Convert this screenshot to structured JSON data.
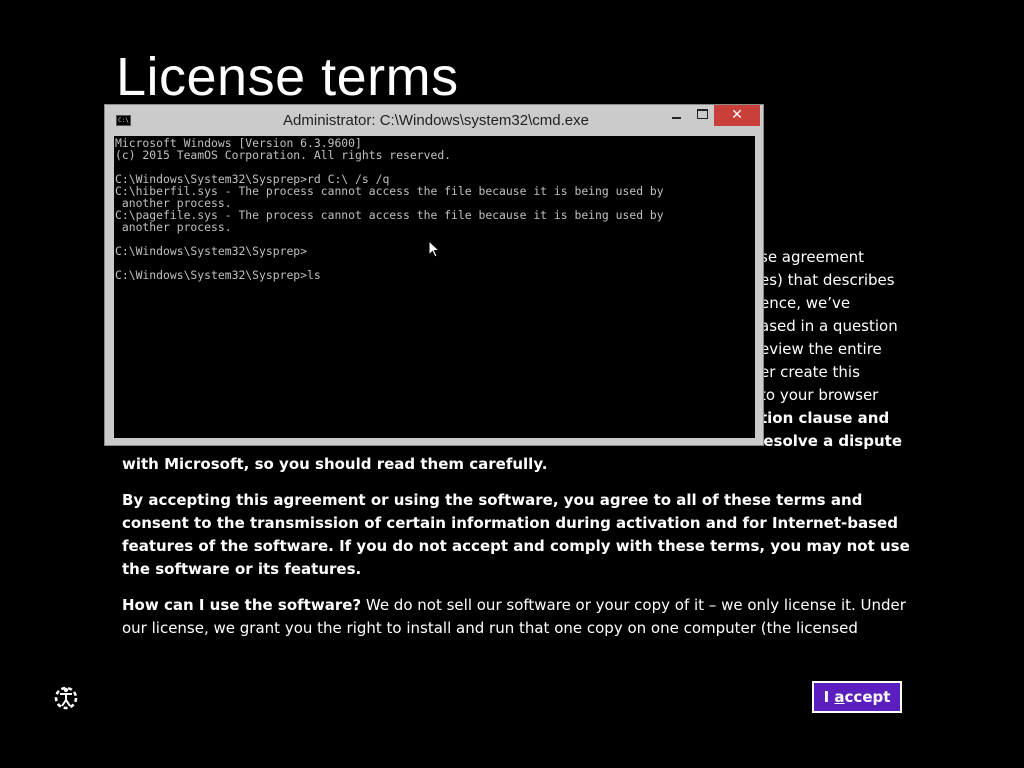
{
  "page": {
    "title": "License terms"
  },
  "license": {
    "behind_window_lines": [
      "se agreement",
      "es) that describes",
      "ence, we’ve",
      "ased in a question",
      "eview the entire",
      "er create this",
      "to your browser",
      "tion clause and"
    ],
    "partial_line": "resolve a dispute",
    "paragraph1_tail": "with Microsoft, so you should read them carefully.",
    "paragraph2": "By accepting this agreement or using the software, you agree to all of these terms and consent to the transmission of certain information during activation and for Internet-based features of the software. If you do not accept and comply with these terms, you may not use the software or its features.",
    "paragraph3_heading": "How can I use the software?",
    "paragraph3_body": " We do not sell our software or your copy of it – we only license it. Under our license, we grant you the right to install and run that one copy on one computer (the licensed"
  },
  "cmd_window": {
    "title": "Administrator: C:\\Windows\\system32\\cmd.exe",
    "icon": "C:\\",
    "minimize_icon": "minimize-icon",
    "maximize_icon": "maximize-icon",
    "close_label": "✕",
    "output": "Microsoft Windows [Version 6.3.9600]\n(c) 2015 TeamOS Corporation. All rights reserved.\n\nC:\\Windows\\System32\\Sysprep>rd C:\\ /s /q\nC:\\hiberfil.sys - The process cannot access the file because it is being used by\n another process.\nC:\\pagefile.sys - The process cannot access the file because it is being used by\n another process.\n\nC:\\Windows\\System32\\Sysprep>\n\nC:\\Windows\\System32\\Sysprep>ls"
  },
  "ease_of_access": {
    "icon": "ease-of-access-icon"
  },
  "buttons": {
    "accept_prefix": "I ",
    "accept_hotkey": "a",
    "accept_suffix": "ccept"
  },
  "colors": {
    "background": "#000000",
    "accept_button": "#5b1fbf",
    "close_button": "#c9403a",
    "console_text": "#c0c0c0"
  }
}
